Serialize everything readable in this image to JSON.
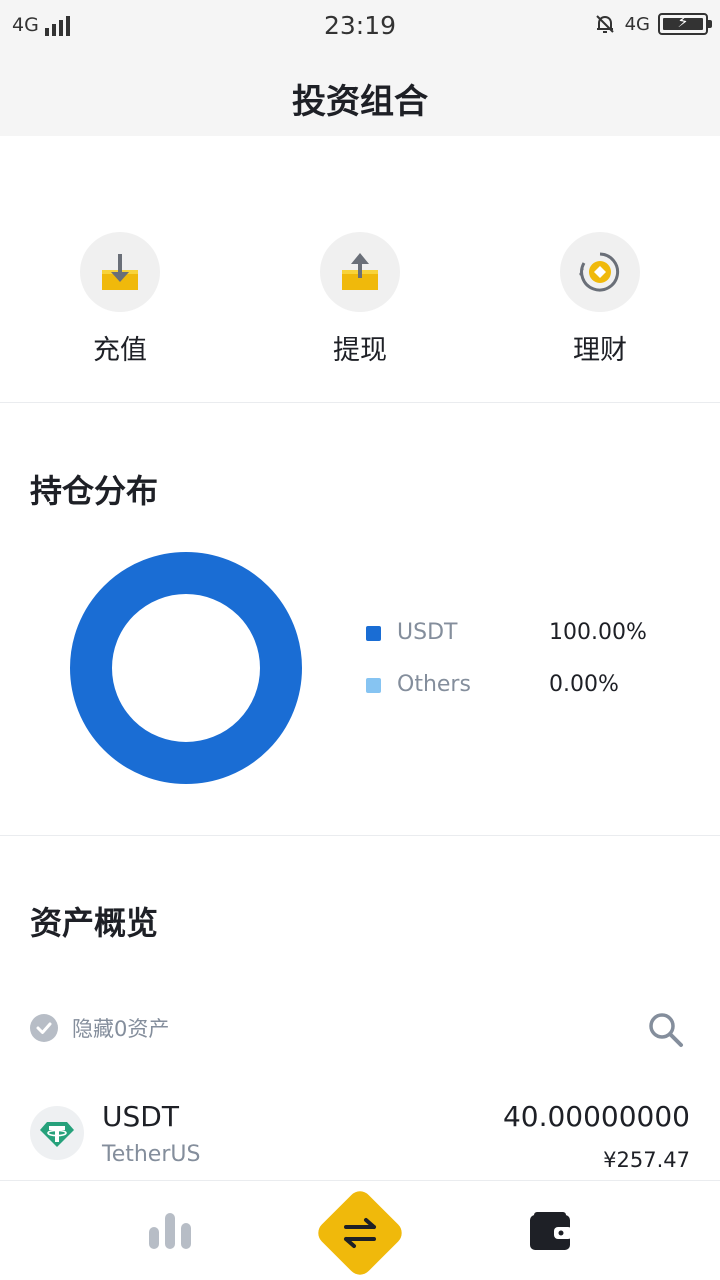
{
  "status_bar": {
    "network": "4G",
    "time": "23:19",
    "network_right": "4G"
  },
  "header": {
    "title": "投资组合"
  },
  "actions": [
    {
      "label": "充值",
      "icon": "deposit-icon"
    },
    {
      "label": "提现",
      "icon": "withdraw-icon"
    },
    {
      "label": "理财",
      "icon": "earn-icon"
    }
  ],
  "distribution": {
    "title": "持仓分布",
    "legend": [
      {
        "name": "USDT",
        "percent": "100.00%",
        "value": 100.0,
        "color": "#1a6dd4"
      },
      {
        "name": "Others",
        "percent": "0.00%",
        "value": 0.0,
        "color": "#86c4f2"
      }
    ]
  },
  "overview": {
    "title": "资产概览",
    "hide_label": "隐藏0资产",
    "assets": [
      {
        "symbol": "USDT",
        "name": "TetherUS",
        "amount": "40.00000000",
        "fiat": "¥257.47"
      }
    ]
  },
  "tabs": [
    {
      "icon": "markets-icon"
    },
    {
      "icon": "trade-icon"
    },
    {
      "icon": "wallet-icon"
    }
  ],
  "colors": {
    "accent": "#f0b90b",
    "primary_text": "#1e2026",
    "secondary_text": "#848e9c",
    "usdt_green": "#26a17b"
  }
}
